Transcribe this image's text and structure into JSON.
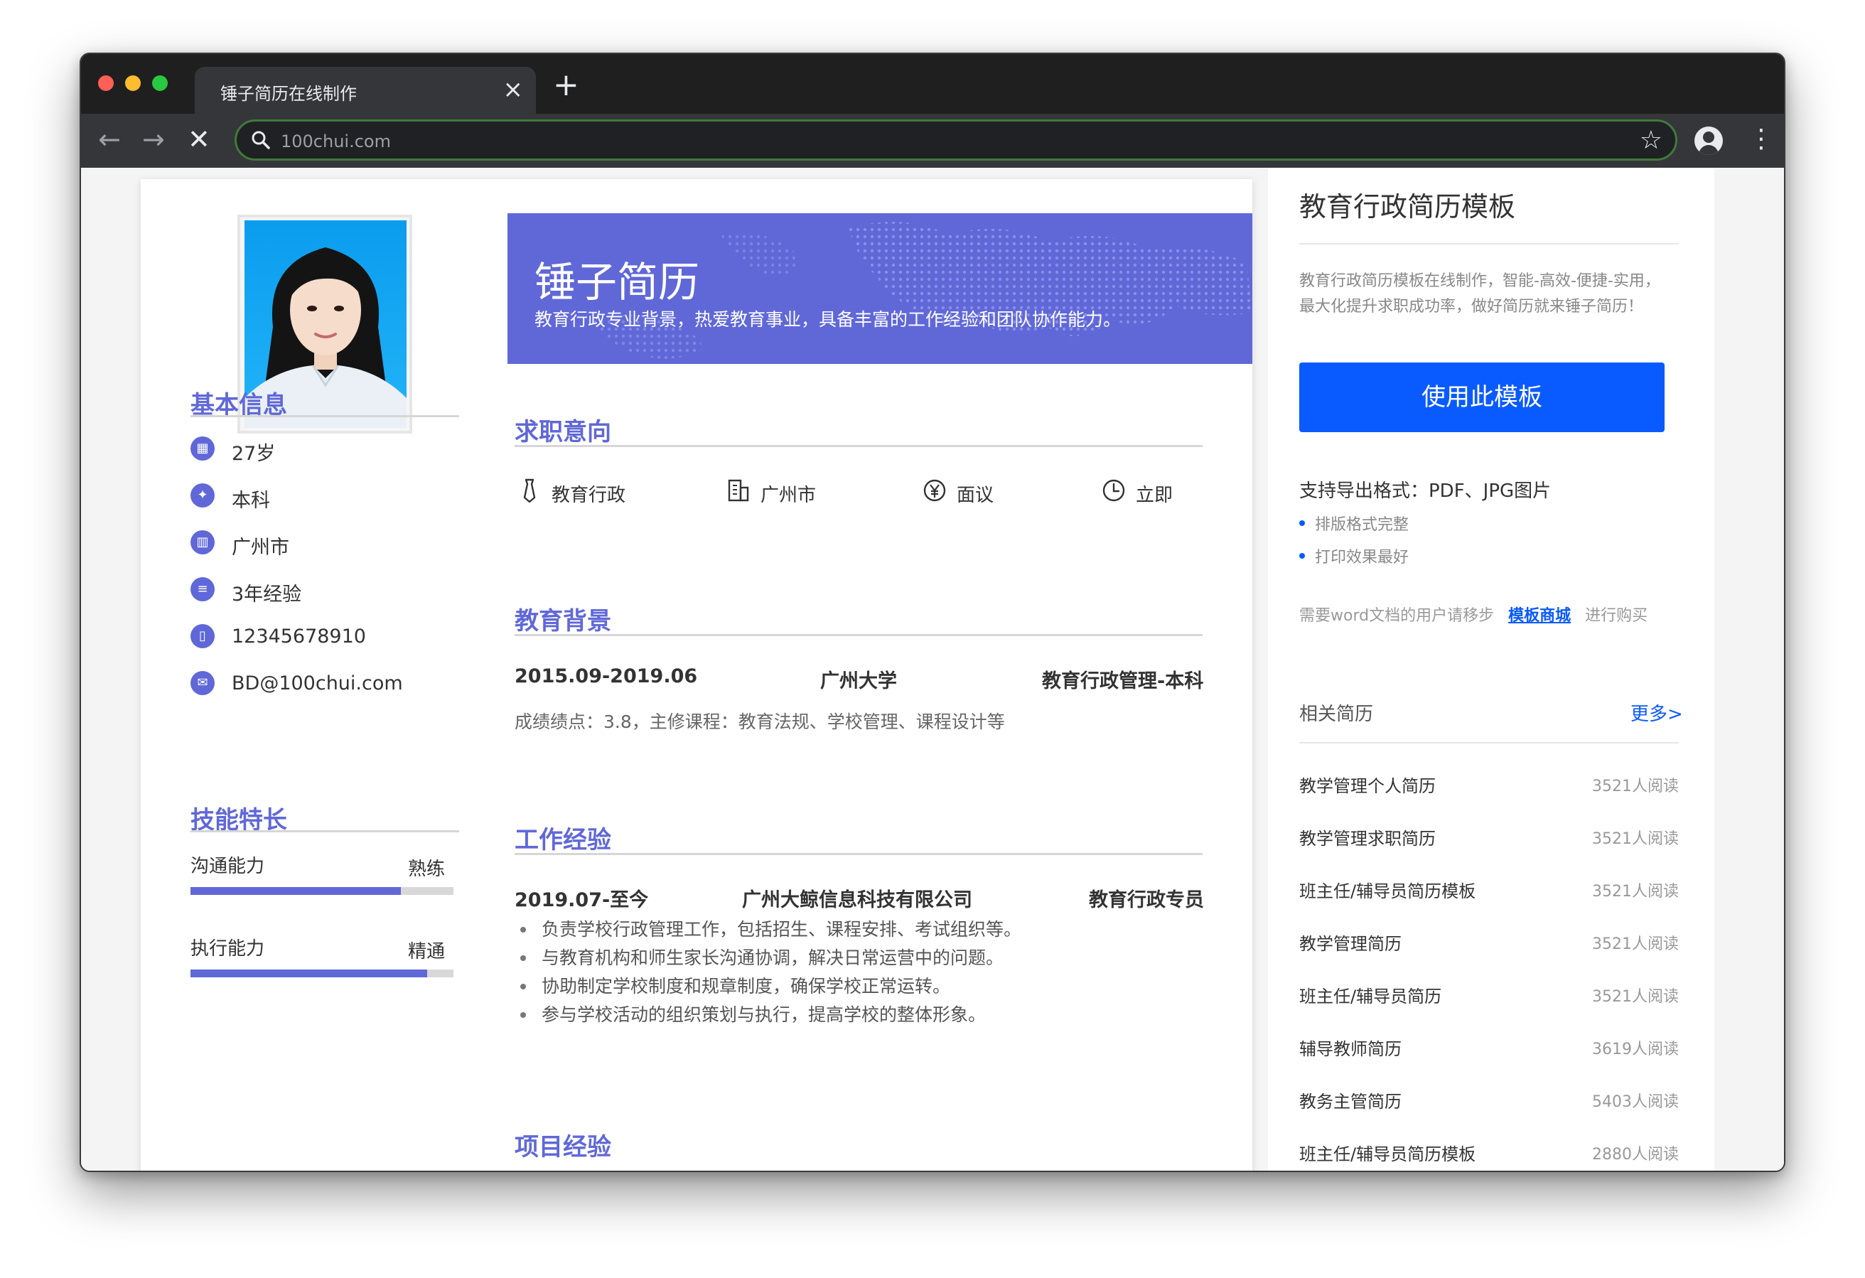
{
  "browser": {
    "tab_title": "锤子简历在线制作",
    "tab_close": "×",
    "new_tab": "+",
    "url": "100chui.com",
    "star": "☆",
    "menu": "⋮",
    "back": "←",
    "forward": "→",
    "stop": "✕"
  },
  "resume": {
    "name": "锤子简历",
    "tagline": "教育行政专业背景，热爱教育事业，具备丰富的工作经验和团队协作能力。",
    "basic_info_title": "基本信息",
    "basic_info": [
      {
        "icon": "calendar-icon",
        "text": "27岁"
      },
      {
        "icon": "graduation-icon",
        "text": "本科"
      },
      {
        "icon": "building-icon",
        "text": "广州市"
      },
      {
        "icon": "clipboard-icon",
        "text": "3年经验"
      },
      {
        "icon": "phone-icon",
        "text": "12345678910"
      },
      {
        "icon": "mail-icon",
        "text": "BD@100chui.com"
      }
    ],
    "skills_title": "技能特长",
    "skills": [
      {
        "name": "沟通能力",
        "level": "熟练",
        "fraction": 0.8
      },
      {
        "name": "执行能力",
        "level": "精通",
        "fraction": 0.9
      }
    ],
    "intent_title": "求职意向",
    "intent": [
      {
        "icon": "tie-icon",
        "text": "教育行政"
      },
      {
        "icon": "office-icon",
        "text": "广州市"
      },
      {
        "icon": "yen-icon",
        "text": "面议"
      },
      {
        "icon": "clock-icon",
        "text": "立即"
      }
    ],
    "education_title": "教育背景",
    "education": {
      "period": "2015.09-2019.06",
      "school": "广州大学",
      "major": "教育行政管理-本科",
      "detail": "成绩绩点：3.8，主修课程：教育法规、学校管理、课程设计等"
    },
    "work_title": "工作经验",
    "work": {
      "period": "2019.07-至今",
      "company": "广州大鲸信息科技有限公司",
      "position": "教育行政专员",
      "bullets": [
        "负责学校行政管理工作，包括招生、课程安排、考试组织等。",
        "与教育机构和师生家长沟通协调，解决日常运营中的问题。",
        "协助制定学校制度和规章制度，确保学校正常运转。",
        "参与学校活动的组织策划与执行，提高学校的整体形象。"
      ]
    },
    "project_title": "项目经验"
  },
  "sidebar": {
    "title": "教育行政简历模板",
    "desc_line1": "教育行政简历模板在线制作，智能-高效-便捷-实用，",
    "desc_line2": "最大化提升求职成功率，做好简历就来锤子简历！",
    "use_button": "使用此模板",
    "formats": "支持导出格式：PDF、JPG图片",
    "features": [
      "排版格式完整",
      "打印效果最好"
    ],
    "word_prefix": "需要word文档的用户请移步",
    "word_link": "模板商城",
    "word_suffix": "进行购买",
    "related_title": "相关简历",
    "more": "更多>",
    "related": [
      {
        "title": "教学管理个人简历",
        "count": "3521人阅读"
      },
      {
        "title": "教学管理求职简历",
        "count": "3521人阅读"
      },
      {
        "title": "班主任/辅导员简历模板",
        "count": "3521人阅读"
      },
      {
        "title": "教学管理简历",
        "count": "3521人阅读"
      },
      {
        "title": "班主任/辅导员简历",
        "count": "3521人阅读"
      },
      {
        "title": "辅导教师简历",
        "count": "3619人阅读"
      },
      {
        "title": "教务主管简历",
        "count": "5403人阅读"
      },
      {
        "title": "班主任/辅导员简历模板",
        "count": "2880人阅读"
      }
    ]
  },
  "colors": {
    "accent": "#6068d8",
    "primary_button": "#0a5bff",
    "chrome_dark": "#202124"
  }
}
